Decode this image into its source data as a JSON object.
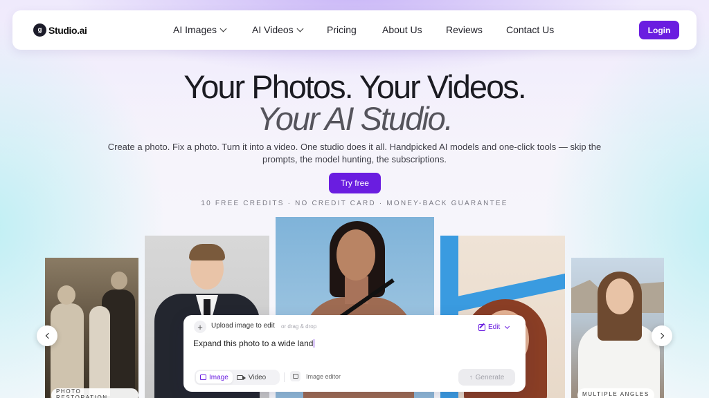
{
  "brand": {
    "logo_text": "Studio.ai",
    "logo_glyph": "g",
    "accent": "#6a1de0"
  },
  "nav": {
    "items": [
      {
        "label": "AI Images",
        "dropdown": true
      },
      {
        "label": "AI Videos",
        "dropdown": true
      },
      {
        "label": "Pricing",
        "dropdown": false
      },
      {
        "label": "About Us",
        "dropdown": false
      },
      {
        "label": "Reviews",
        "dropdown": false
      },
      {
        "label": "Contact Us",
        "dropdown": false
      }
    ],
    "login_label": "Login"
  },
  "hero": {
    "title_line1": "Your Photos. Your Videos.",
    "title_line2": "Your AI Studio.",
    "subtitle": "Create a photo. Fix a photo. Turn it into a video. One studio does it all. Handpicked AI models and one-click tools — skip the prompts, the model hunting, the subscriptions.",
    "cta_label": "Try free",
    "credits_note": "10 FREE CREDITS · NO CREDIT CARD · MONEY-BACK GUARANTEE"
  },
  "gallery": {
    "items": [
      {
        "badge": "PHOTO RESTORATION"
      },
      {
        "badge": ""
      },
      {
        "badge": ""
      },
      {
        "badge": ""
      },
      {
        "badge": "MULTIPLE ANGLES"
      }
    ],
    "prev_icon": "chevron-left-icon",
    "next_icon": "chevron-right-icon"
  },
  "prompt_card": {
    "upload_label": "Upload image to edit",
    "upload_hint": "or drag & drop",
    "edit_label": "Edit",
    "prompt_value": "Expand this photo to a wide land",
    "modes": [
      {
        "label": "Image",
        "active": true
      },
      {
        "label": "Video",
        "active": false
      }
    ],
    "image_editor_label": "Image editor",
    "generate_label": "Generate"
  }
}
